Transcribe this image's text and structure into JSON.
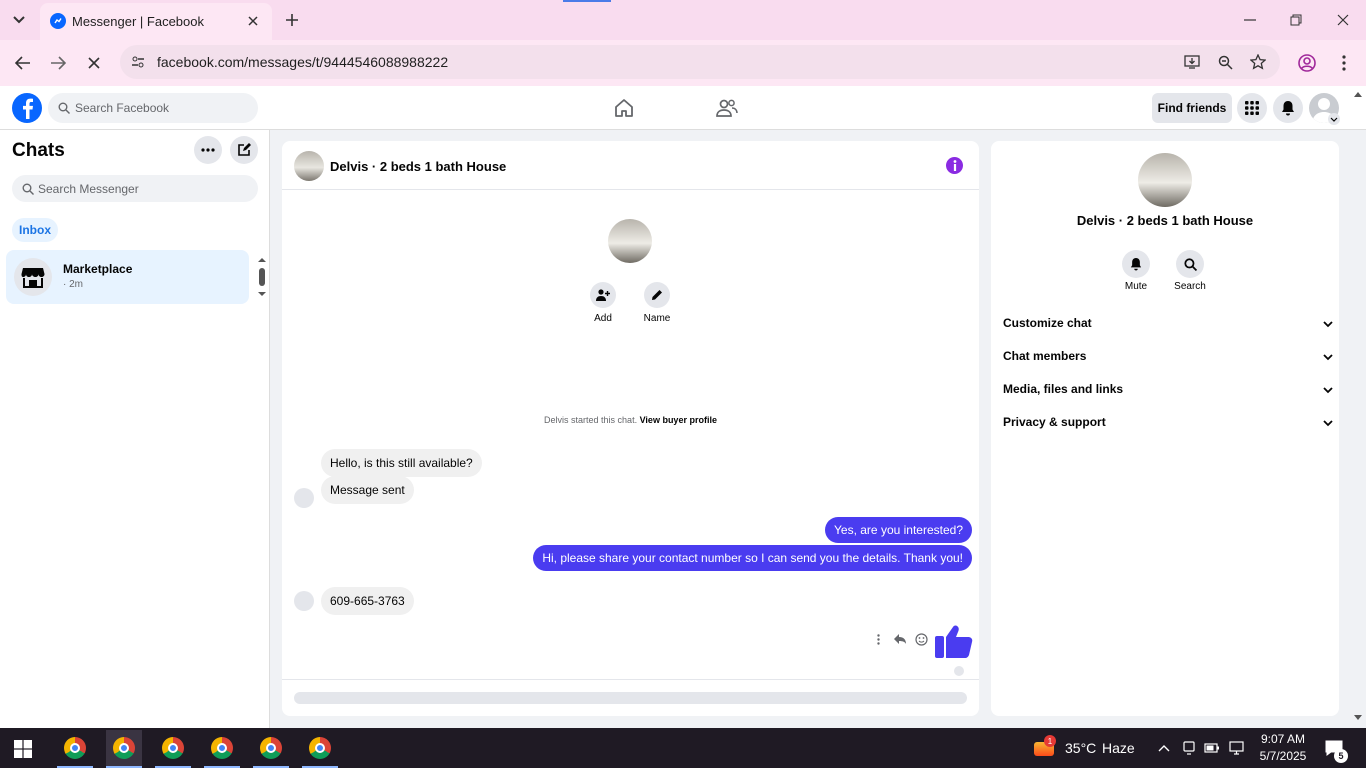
{
  "browser": {
    "tab_title": "Messenger | Facebook",
    "url": "facebook.com/messages/t/9444546088988222"
  },
  "fb_header": {
    "search_placeholder": "Search Facebook",
    "find_friends_label": "Find friends"
  },
  "chats_panel": {
    "title": "Chats",
    "search_placeholder": "Search Messenger",
    "inbox_label": "Inbox",
    "items": [
      {
        "name": "Marketplace",
        "time": "· 2m"
      }
    ]
  },
  "conversation": {
    "title": "Delvis · 2 beds 1 bath House",
    "actions": [
      {
        "label": "Add",
        "icon": "add-person-icon"
      },
      {
        "label": "Name",
        "icon": "pencil-icon"
      }
    ],
    "started_note": "Delvis started this chat.",
    "view_profile_link": "View buyer profile",
    "messages": [
      {
        "direction": "in",
        "text": "Hello, is this still available?"
      },
      {
        "direction": "in",
        "text": "Message sent"
      },
      {
        "direction": "out",
        "text": "Yes, are you interested?"
      },
      {
        "direction": "out",
        "text": "Hi, please share your contact number so I can send you the details. Thank you!"
      },
      {
        "direction": "in",
        "text": "609-665-3763"
      }
    ]
  },
  "info_panel": {
    "title": "Delvis · 2 beds 1 bath House",
    "buttons": [
      {
        "label": "Mute",
        "icon": "bell-icon"
      },
      {
        "label": "Search",
        "icon": "search-icon"
      }
    ],
    "sections": [
      "Customize chat",
      "Chat members",
      "Media, files and links",
      "Privacy & support"
    ]
  },
  "taskbar": {
    "weather_temp": "35°C",
    "weather_desc": "Haze",
    "weather_badge": "1",
    "time": "9:07 AM",
    "date": "5/7/2025",
    "notification_count": "5"
  },
  "colors": {
    "accent": "#4a3cf0",
    "info_icon": "#8a2be2",
    "facebook_blue": "#0866ff",
    "tab_bar": "#f9dcef"
  }
}
